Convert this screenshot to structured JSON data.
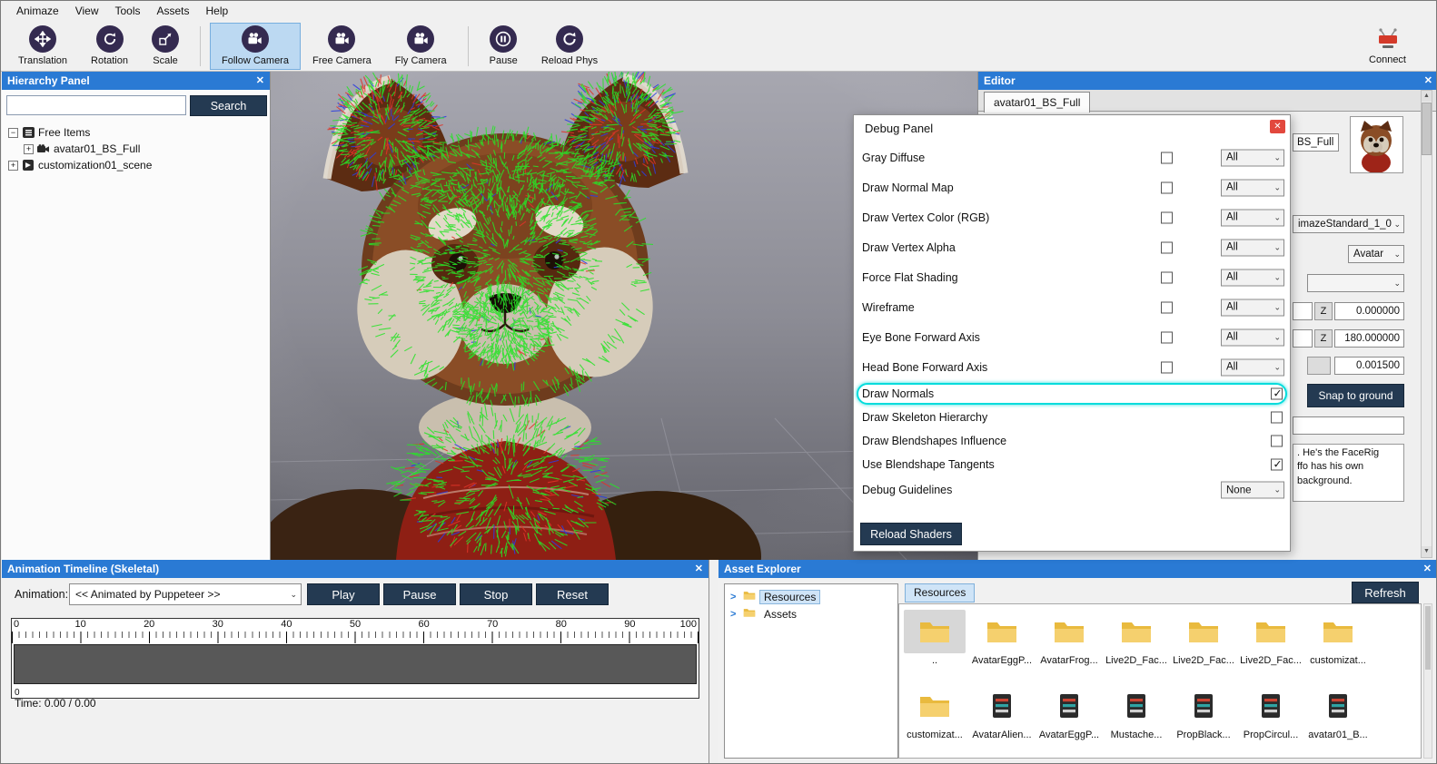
{
  "icons": {
    "close": "✕",
    "chevron_down": "⌄",
    "plus": "+",
    "minus": "−",
    "tree_chevron": ">",
    "scroll_up": "▲",
    "scroll_down": "▼"
  },
  "colors": {
    "titlebar": "#2a7ad4",
    "dark_button": "#243a52",
    "highlight_cyan": "#00dcdc",
    "normals_green": "#27e427",
    "normals_red": "#e03428",
    "normals_blue": "#2b3ee0"
  },
  "menu": {
    "items": [
      "Animaze",
      "View",
      "Tools",
      "Assets",
      "Help"
    ]
  },
  "toolbar": {
    "items": [
      {
        "label": "Translation"
      },
      {
        "label": "Rotation"
      },
      {
        "label": "Scale"
      },
      {
        "label": "Follow Camera",
        "active": true
      },
      {
        "label": "Free Camera"
      },
      {
        "label": "Fly Camera"
      },
      {
        "label": "Pause"
      },
      {
        "label": "Reload Phys"
      }
    ],
    "connect": {
      "label": "Connect"
    }
  },
  "hierarchy_panel": {
    "title": "Hierarchy Panel",
    "search_placeholder": "",
    "search_button": "Search",
    "tree": [
      {
        "label": "Free Items"
      },
      {
        "label": "avatar01_BS_Full"
      },
      {
        "label": "customization01_scene"
      }
    ]
  },
  "editor_panel": {
    "title": "Editor",
    "tab": "avatar01_BS_Full",
    "name_field": "BS_Full",
    "standard_dropdown": "imazeStandard_1_0",
    "type_dropdown": "Avatar",
    "rot_z_label": "Z",
    "rot_z_value": "0.000000",
    "rot2_z_label": "Z",
    "rot2_z_value": "180.000000",
    "scale_value": "0.001500",
    "snap_button": "Snap to ground",
    "description_lines": [
      ". He's the FaceRig",
      "ffo has his own",
      "background."
    ]
  },
  "debug_panel": {
    "title": "Debug Panel",
    "rows": [
      {
        "label": "Gray Diffuse",
        "checked": false,
        "dropdown": "All"
      },
      {
        "label": "Draw Normal Map",
        "checked": false,
        "dropdown": "All"
      },
      {
        "label": "Draw Vertex Color (RGB)",
        "checked": false,
        "dropdown": "All"
      },
      {
        "label": "Draw Vertex Alpha",
        "checked": false,
        "dropdown": "All"
      },
      {
        "label": "Force Flat Shading",
        "checked": false,
        "dropdown": "All"
      },
      {
        "label": "Wireframe",
        "checked": false,
        "dropdown": "All"
      },
      {
        "label": "Eye Bone Forward Axis",
        "checked": false,
        "dropdown": "All"
      },
      {
        "label": "Head Bone Forward Axis",
        "checked": false,
        "dropdown": "All"
      },
      {
        "label": "Draw Normals",
        "checked": true,
        "highlighted": true
      },
      {
        "label": "Draw Skeleton Hierarchy",
        "checked": false
      },
      {
        "label": "Draw Blendshapes Influence",
        "checked": false
      },
      {
        "label": "Use Blendshape Tangents",
        "checked": true
      },
      {
        "label": "Debug Guidelines",
        "dropdown": "None"
      }
    ],
    "reload_button": "Reload Shaders"
  },
  "timeline_panel": {
    "title": "Animation Timeline (Skeletal)",
    "animation_label": "Animation:",
    "animation_dropdown": "<< Animated by Puppeteer >>",
    "play": "Play",
    "pause": "Pause",
    "stop": "Stop",
    "reset": "Reset",
    "ruler_ticks": [
      "0",
      "10",
      "20",
      "30",
      "40",
      "50",
      "60",
      "70",
      "80",
      "90",
      "100"
    ],
    "ruler_zero": "0",
    "time_label": "Time: 0.00 / 0.00"
  },
  "asset_explorer": {
    "title": "Asset Explorer",
    "tree": [
      {
        "label": "Resources",
        "selected": true
      },
      {
        "label": "Assets"
      }
    ],
    "tab": "Resources",
    "refresh_button": "Refresh",
    "items": [
      {
        "name": "..",
        "type": "folder",
        "selected": true
      },
      {
        "name": "AvatarEggP...",
        "type": "folder"
      },
      {
        "name": "AvatarFrog...",
        "type": "folder"
      },
      {
        "name": "Live2D_Fac...",
        "type": "folder"
      },
      {
        "name": "Live2D_Fac...",
        "type": "folder"
      },
      {
        "name": "Live2D_Fac...",
        "type": "folder"
      },
      {
        "name": "customizat...",
        "type": "folder"
      },
      {
        "name": "customizat...",
        "type": "folder"
      },
      {
        "name": "AvatarAlien...",
        "type": "file"
      },
      {
        "name": "AvatarEggP...",
        "type": "file"
      },
      {
        "name": "Mustache...",
        "type": "file"
      },
      {
        "name": "PropBlack...",
        "type": "file"
      },
      {
        "name": "PropCircul...",
        "type": "file"
      },
      {
        "name": "avatar01_B...",
        "type": "file"
      }
    ]
  }
}
